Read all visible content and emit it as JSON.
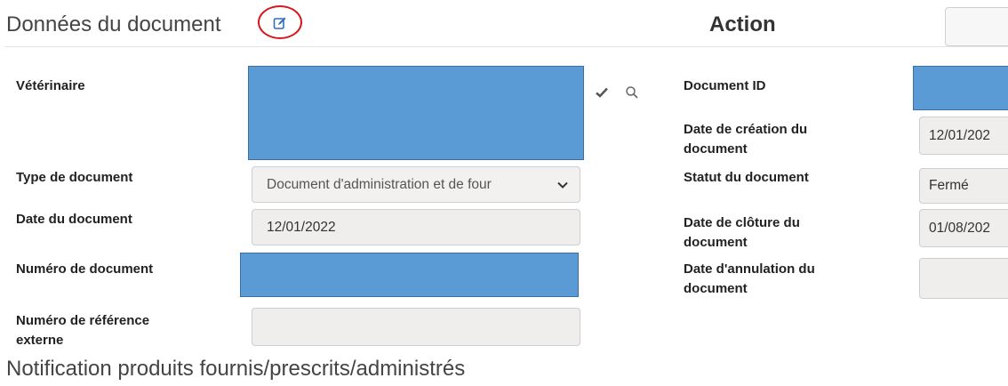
{
  "header": {
    "title": "Données du document",
    "action_title": "Action"
  },
  "form": {
    "veterinaire_label": "Vétérinaire",
    "type_document_label": "Type de document",
    "type_document_value": "Document d'administration et de four",
    "date_document_label": "Date du document",
    "date_document_value": "12/01/2022",
    "numero_document_label": "Numéro de document",
    "numero_reference_label_1": "Numéro de référence",
    "numero_reference_label_2": "externe",
    "numero_reference_value": ""
  },
  "side": {
    "document_id_label": "Document ID",
    "date_creation_label_1": "Date de création du",
    "date_creation_label_2": "document",
    "date_creation_value": "12/01/202",
    "statut_label": "Statut du document",
    "statut_value": "Fermé",
    "date_cloture_label_1": "Date de clôture du",
    "date_cloture_label_2": "document",
    "date_cloture_value": "01/08/202",
    "date_annulation_label_1": "Date d'annulation du",
    "date_annulation_label_2": "document",
    "date_annulation_value": ""
  },
  "footer": {
    "notification_title": "Notification produits fournis/prescrits/administrés"
  },
  "icons": {
    "edit": "edit-icon",
    "check": "check-icon",
    "search": "search-icon",
    "chevron": "chevron-down-icon"
  },
  "colors": {
    "redaction": "#5b9bd5",
    "highlight_circle": "#d9141b",
    "edit_icon": "#2f6fbf"
  }
}
